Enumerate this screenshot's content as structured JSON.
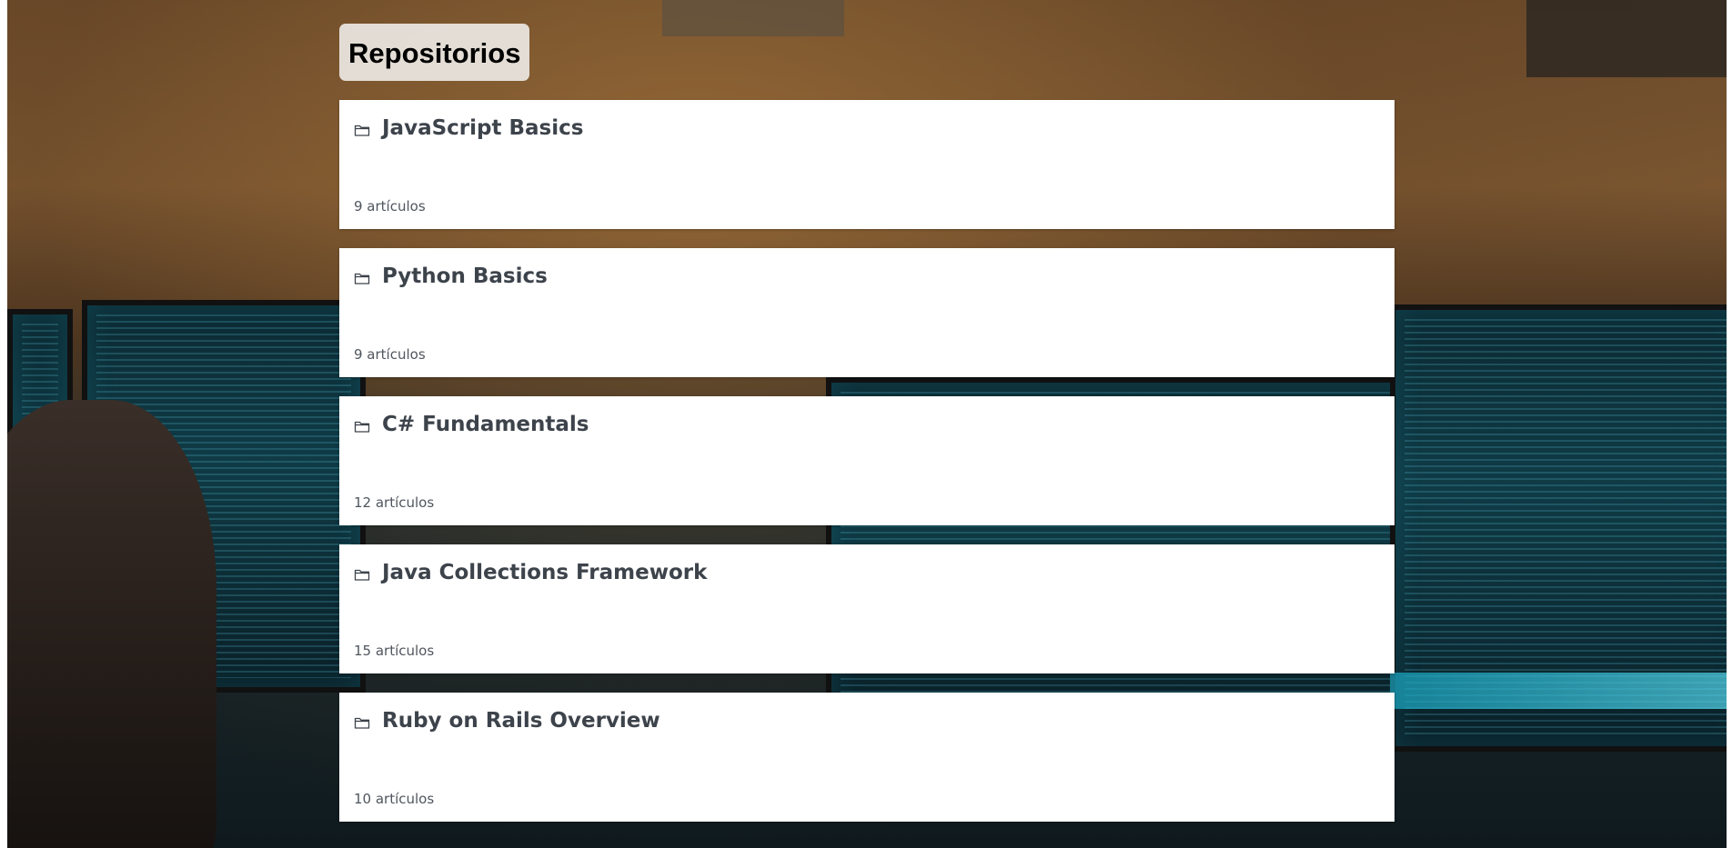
{
  "page": {
    "title": "Repositorios"
  },
  "repositories": [
    {
      "name": "JavaScript Basics",
      "count": "9 artículos",
      "icon": "folder-icon"
    },
    {
      "name": "Python Basics",
      "count": "9 artículos",
      "icon": "folder-icon"
    },
    {
      "name": "C# Fundamentals",
      "count": "12 artículos",
      "icon": "folder-icon"
    },
    {
      "name": "Java Collections Framework",
      "count": "15 artículos",
      "icon": "folder-icon"
    },
    {
      "name": "Ruby on Rails Overview",
      "count": "10 artículos",
      "icon": "folder-icon"
    }
  ],
  "colors": {
    "card_background": "#ffffff",
    "repo_title": "#3d434b",
    "repo_count": "#50565e",
    "title_background": "#ebe8e4"
  }
}
